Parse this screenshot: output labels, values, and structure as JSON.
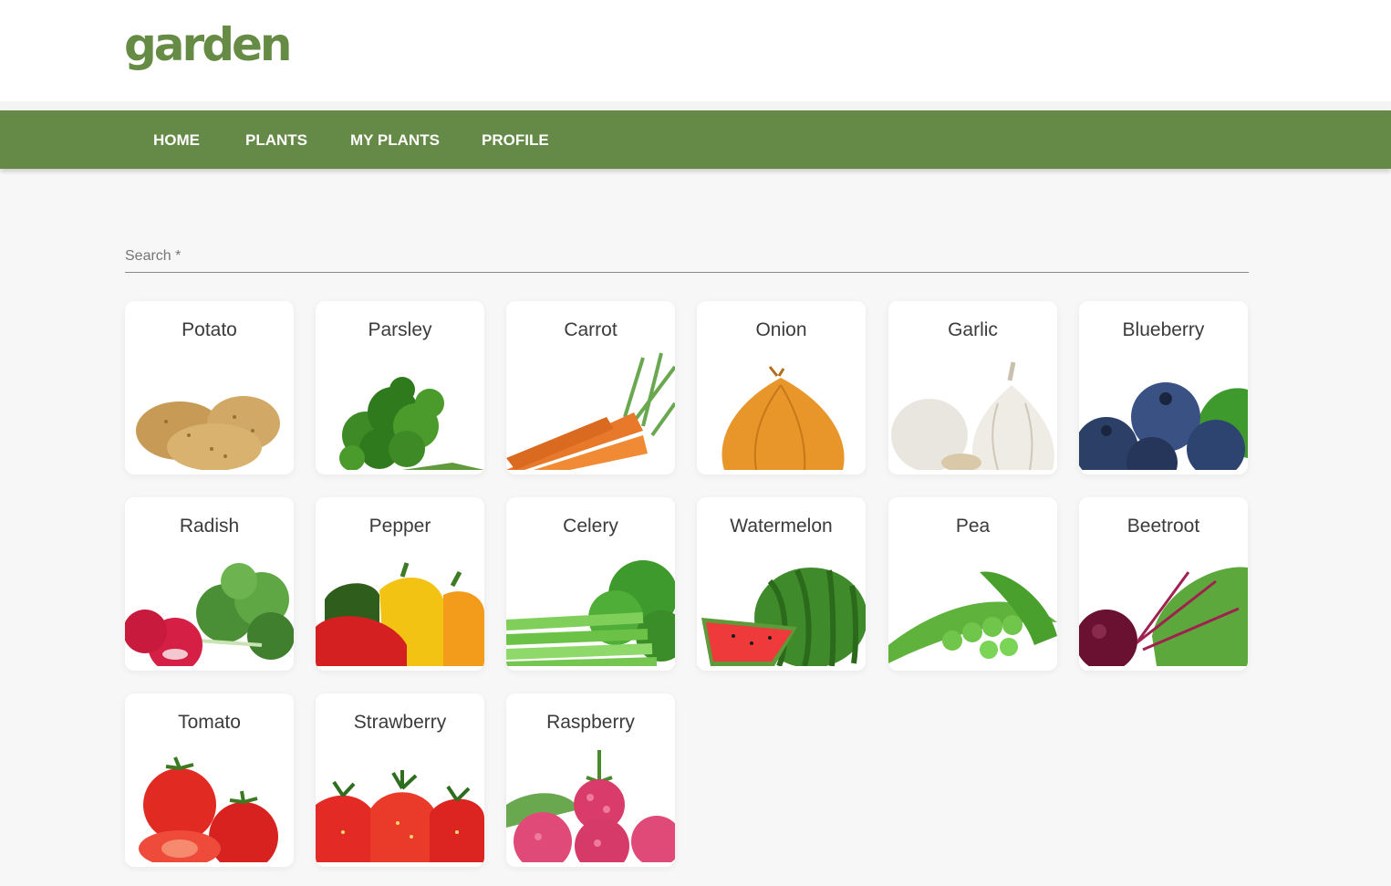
{
  "logo": "garden",
  "nav": [
    "HOME",
    "PLANTS",
    "MY PLANTS",
    "PROFILE"
  ],
  "search": {
    "label": "Search *"
  },
  "plants": [
    {
      "name": "Potato",
      "image": "potato-icon"
    },
    {
      "name": "Parsley",
      "image": "parsley-icon"
    },
    {
      "name": "Carrot",
      "image": "carrot-icon"
    },
    {
      "name": "Onion",
      "image": "onion-icon"
    },
    {
      "name": "Garlic",
      "image": "garlic-icon"
    },
    {
      "name": "Blueberry",
      "image": "blueberry-icon"
    },
    {
      "name": "Radish",
      "image": "radish-icon"
    },
    {
      "name": "Pepper",
      "image": "pepper-icon"
    },
    {
      "name": "Celery",
      "image": "celery-icon"
    },
    {
      "name": "Watermelon",
      "image": "watermelon-icon"
    },
    {
      "name": "Pea",
      "image": "pea-icon"
    },
    {
      "name": "Beetroot",
      "image": "beetroot-icon"
    },
    {
      "name": "Tomato",
      "image": "tomato-icon"
    },
    {
      "name": "Strawberry",
      "image": "strawberry-icon"
    },
    {
      "name": "Raspberry",
      "image": "raspberry-icon"
    }
  ],
  "colors": {
    "brand": "#658946",
    "logo": "#658b45",
    "background": "#f7f7f7"
  }
}
